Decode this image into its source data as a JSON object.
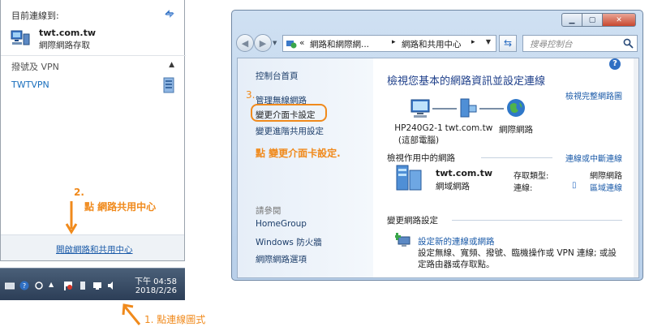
{
  "flyout": {
    "header": "目前連線到:",
    "connection": {
      "name": "twt.com.tw",
      "status": "網際網路存取"
    },
    "section": "撥號及 VPN",
    "vpn_name": "TWTVPN",
    "footer_link": "開啟網路和共用中心"
  },
  "taskbar": {
    "time": "下午 04:58",
    "date": "2018/2/26"
  },
  "annotations": {
    "step1": "1. 點連線圖式",
    "step2_num": "2.",
    "step2": "點 網路共用中心",
    "step3_num": "3.",
    "step3": "點 變更介面卡設定."
  },
  "window": {
    "nav": {
      "back_icon": "back-arrow-icon",
      "forward_icon": "forward-arrow-icon",
      "breadcrumb_sep": "«",
      "seg1": "網路和網際網...",
      "arrow1": "▸",
      "seg2": "網路和共用中心",
      "arrow2": "▸",
      "search_placeholder": "搜尋控制台"
    },
    "sidebar": {
      "home": "控制台首頁",
      "items": [
        "管理無線網路",
        "變更介面卡設定",
        "變更進階共用設定"
      ],
      "see_also": "請參閱",
      "see_also_items": [
        "HomeGroup",
        "Windows 防火牆",
        "網際網路選項"
      ]
    },
    "main": {
      "title": "檢視您基本的網路資訊並設定連線",
      "full_map_link": "檢視完整網路圖",
      "map": [
        {
          "label": "HP240G2-1",
          "sub": "(這部電腦)"
        },
        {
          "label": "twt.com.tw",
          "sub": ""
        },
        {
          "label": "網際網路",
          "sub": ""
        }
      ],
      "active_head": "檢視作用中的網路",
      "active_link": "連線或中斷連線",
      "network": {
        "name": "twt.com.tw",
        "type": "網域網路"
      },
      "access_type_label": "存取類型:",
      "access_type_value": "網際網路",
      "connections_label": "連線:",
      "connections_value": "區域連線",
      "change_head": "變更網路設定",
      "task_link": "設定新的連線或網路",
      "task_desc": "設定無線、寬頻、撥號、臨機操作或 VPN 連線; 或設定路由器或存取點。"
    }
  },
  "colors": {
    "accent": "#f08a1c",
    "link": "#1a5aa8"
  }
}
